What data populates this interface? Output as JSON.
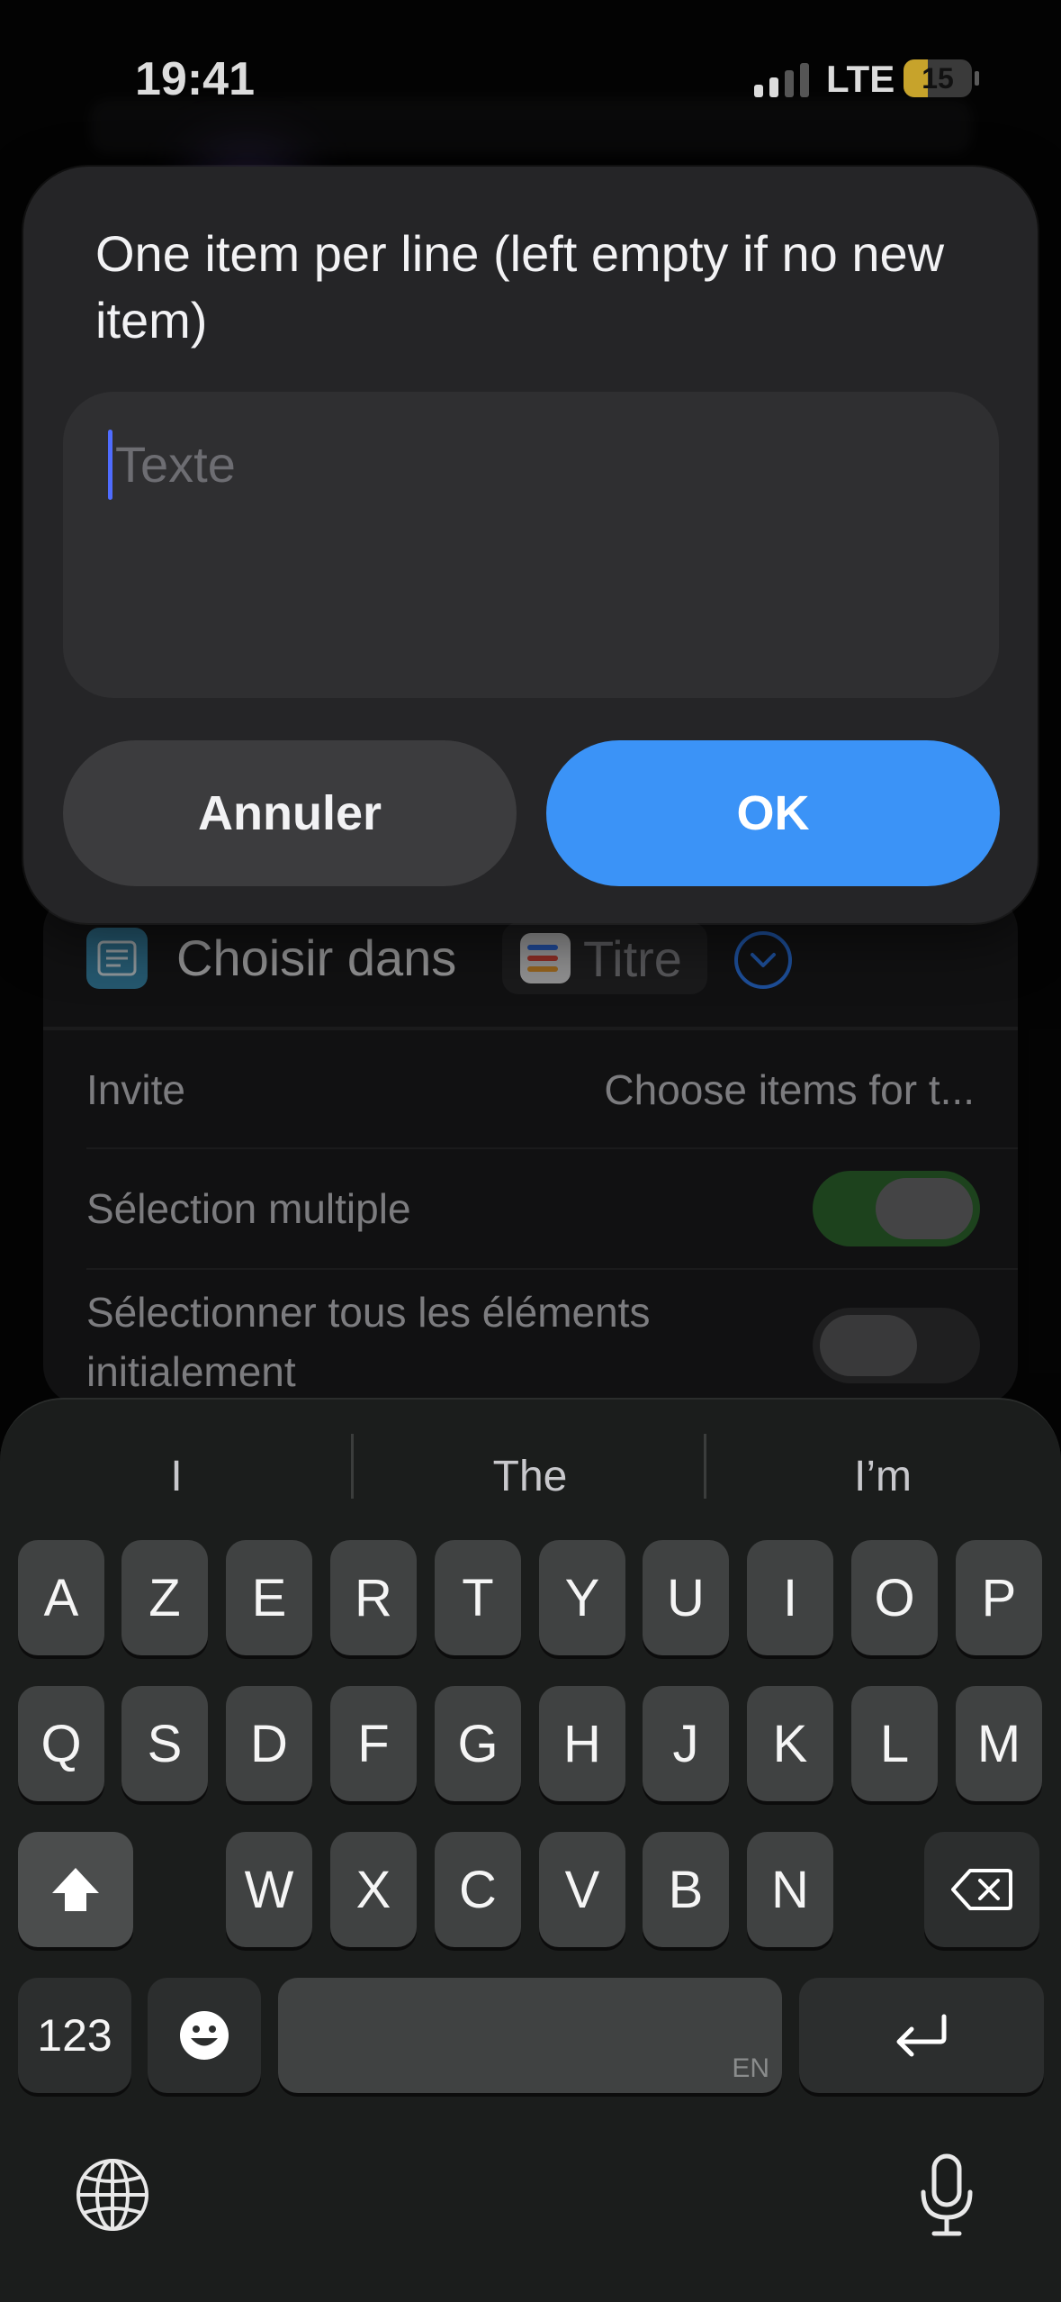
{
  "status_bar": {
    "time": "19:41",
    "network": "LTE",
    "battery": "15",
    "battery_level": 0.15,
    "signal_bars": 2
  },
  "dialog": {
    "message": "One item per line (left empty if no new item)",
    "input_placeholder": "Texte",
    "cancel_label": "Annuler",
    "ok_label": "OK"
  },
  "background_card": {
    "action_label": "Choisir dans",
    "variable_token": "Titre",
    "rows": [
      {
        "label": "Invite",
        "value": "Choose items for t..."
      },
      {
        "label": "Sélection multiple",
        "toggle_on": true
      },
      {
        "label": "Sélectionner tous les éléments initialement",
        "toggle_on": false
      }
    ]
  },
  "keyboard": {
    "suggestions": [
      "I",
      "The",
      "I’m"
    ],
    "row1": [
      "A",
      "Z",
      "E",
      "R",
      "T",
      "Y",
      "U",
      "I",
      "O",
      "P"
    ],
    "row2": [
      "Q",
      "S",
      "D",
      "F",
      "G",
      "H",
      "J",
      "K",
      "L",
      "M"
    ],
    "row3": [
      "W",
      "X",
      "C",
      "V",
      "B",
      "N"
    ],
    "numbers_label": "123",
    "space_language": "EN",
    "icons": {
      "shift": "shift-icon",
      "delete": "delete-icon",
      "emoji": "emoji-icon",
      "return": "return-icon",
      "globe": "globe-icon",
      "dictation": "microphone-icon"
    }
  },
  "colors": {
    "accent": "#3b93f7",
    "caret": "#4f6cff",
    "toggle_on": "#2f6b30",
    "dialog_bg": "#252527"
  }
}
